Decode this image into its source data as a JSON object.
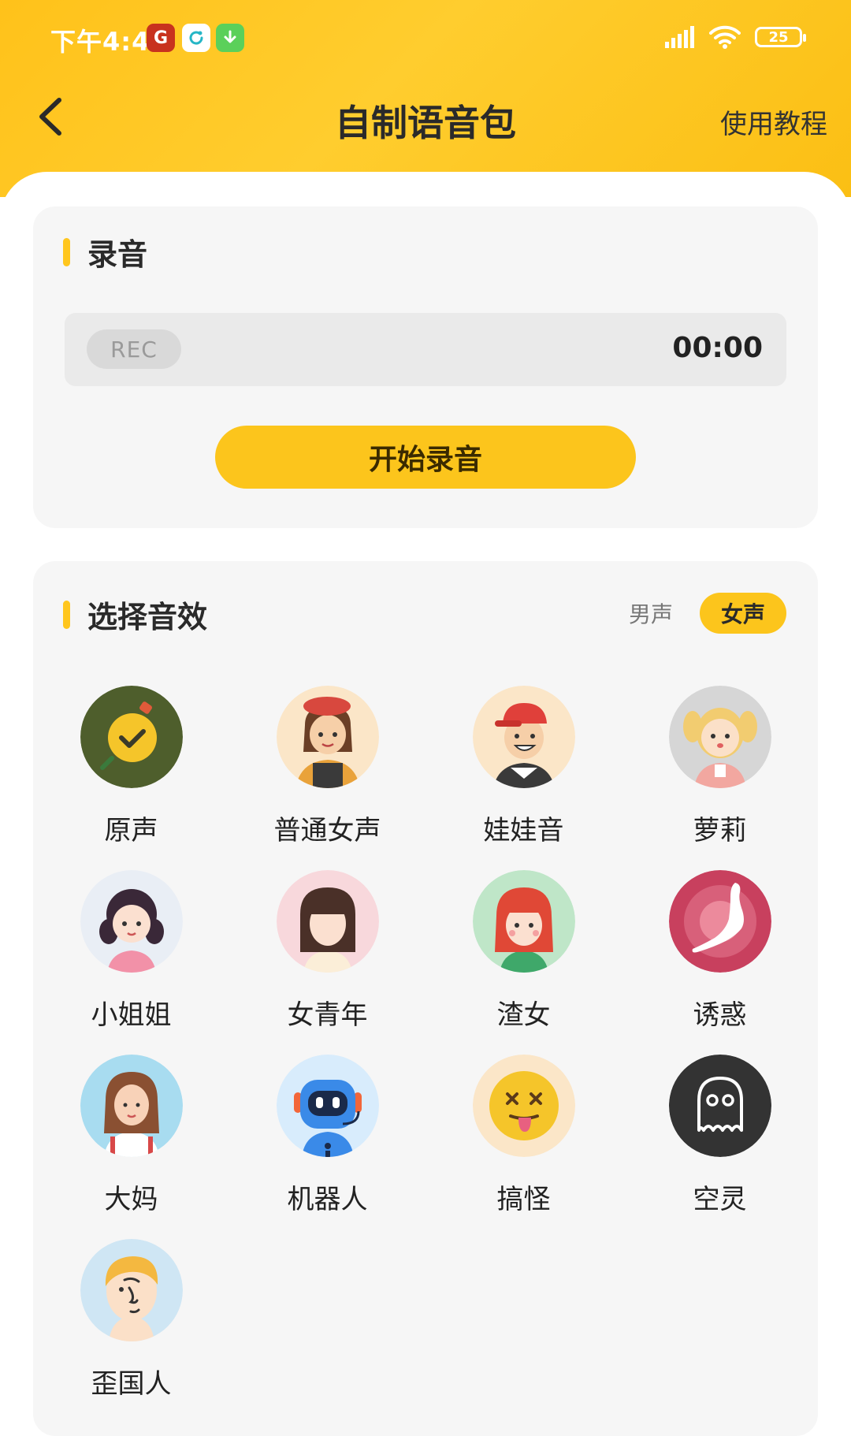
{
  "status_bar": {
    "time": "下午4:41",
    "battery": "25"
  },
  "header": {
    "title": "自制语音包",
    "tutorial_label": "使用教程"
  },
  "recording": {
    "section_title": "录音",
    "rec_badge": "REC",
    "timer": "00:00",
    "start_button": "开始录音"
  },
  "effects": {
    "section_title": "选择音效",
    "gender_options": [
      "男声",
      "女声"
    ],
    "selected_gender": "女声",
    "selected_effect": "原声",
    "items": [
      {
        "label": "原声",
        "icon": "original-voice-icon"
      },
      {
        "label": "普通女声",
        "icon": "woman-beret-avatar-icon"
      },
      {
        "label": "娃娃音",
        "icon": "boy-cap-avatar-icon"
      },
      {
        "label": "萝莉",
        "icon": "little-girl-avatar-icon"
      },
      {
        "label": "小姐姐",
        "icon": "young-lady-avatar-icon"
      },
      {
        "label": "女青年",
        "icon": "young-woman-avatar-icon"
      },
      {
        "label": "渣女",
        "icon": "redhead-girl-avatar-icon"
      },
      {
        "label": "诱惑",
        "icon": "seductive-silhouette-icon"
      },
      {
        "label": "大妈",
        "icon": "auntie-avatar-icon"
      },
      {
        "label": "机器人",
        "icon": "robot-icon"
      },
      {
        "label": "搞怪",
        "icon": "silly-face-icon"
      },
      {
        "label": "空灵",
        "icon": "ghost-icon"
      },
      {
        "label": "歪国人",
        "icon": "foreigner-avatar-icon"
      }
    ]
  },
  "colors": {
    "accent": "#fcc51c",
    "card_bg": "#f6f6f6",
    "rec_box_bg": "#eaeaea"
  }
}
